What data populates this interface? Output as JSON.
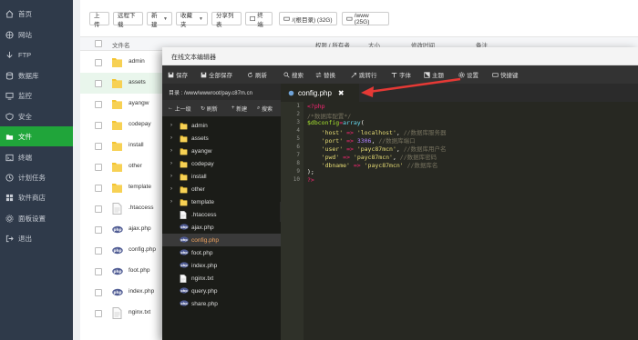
{
  "sidebar": {
    "items": [
      {
        "label": "首页",
        "icon": "home-icon"
      },
      {
        "label": "网站",
        "icon": "globe-icon"
      },
      {
        "label": "FTP",
        "icon": "ftp-icon"
      },
      {
        "label": "数据库",
        "icon": "database-icon"
      },
      {
        "label": "监控",
        "icon": "monitor-icon"
      },
      {
        "label": "安全",
        "icon": "shield-icon"
      },
      {
        "label": "文件",
        "icon": "folder-icon",
        "active": true
      },
      {
        "label": "终端",
        "icon": "terminal-icon"
      },
      {
        "label": "计划任务",
        "icon": "clock-icon"
      },
      {
        "label": "软件商店",
        "icon": "store-icon"
      },
      {
        "label": "面板设置",
        "icon": "gear-icon"
      },
      {
        "label": "退出",
        "icon": "logout-icon"
      }
    ]
  },
  "toolbar": {
    "upload": "上传",
    "remote_download": "远程下载",
    "new": "新建",
    "favorites": "收藏夹",
    "share_list": "分享列表",
    "terminal": "终端",
    "disk_root": "/(根目录) (32G)",
    "disk_www": "/www (25G)"
  },
  "table": {
    "headers": {
      "name": "文件名",
      "perm": "权限 / 所有者",
      "size": "大小",
      "mtime": "修改时间",
      "remark": "备注"
    },
    "rows": [
      {
        "name": "admin",
        "type": "folder"
      },
      {
        "name": "assets",
        "type": "folder"
      },
      {
        "name": "ayangw",
        "type": "folder"
      },
      {
        "name": "codepay",
        "type": "folder"
      },
      {
        "name": "install",
        "type": "folder"
      },
      {
        "name": "other",
        "type": "folder"
      },
      {
        "name": "template",
        "type": "folder"
      },
      {
        "name": ".htaccess",
        "type": "file"
      },
      {
        "name": "ajax.php",
        "type": "php"
      },
      {
        "name": "config.php",
        "type": "php"
      },
      {
        "name": "foot.php",
        "type": "php"
      },
      {
        "name": "index.php",
        "type": "php"
      },
      {
        "name": "nginx.txt",
        "type": "file"
      }
    ]
  },
  "editor": {
    "title": "在线文本编辑器",
    "menu": {
      "save": "保存",
      "save_all": "全部保存",
      "refresh": "刷新",
      "search": "搜索",
      "replace": "替换",
      "goto": "跳转行",
      "font": "字体",
      "theme": "主题",
      "settings": "设置",
      "shortcuts": "快捷键"
    },
    "path_label": "目录 : /www/wwwroot/pay.c87m.cn",
    "left_toolbar": {
      "up": "上一级",
      "refresh": "刷新",
      "new": "新建",
      "search": "搜索"
    },
    "tree": [
      {
        "name": "admin",
        "type": "folder"
      },
      {
        "name": "assets",
        "type": "folder"
      },
      {
        "name": "ayangw",
        "type": "folder"
      },
      {
        "name": "codepay",
        "type": "folder"
      },
      {
        "name": "install",
        "type": "folder"
      },
      {
        "name": "other",
        "type": "folder"
      },
      {
        "name": "template",
        "type": "folder"
      },
      {
        "name": ".htaccess",
        "type": "file"
      },
      {
        "name": "ajax.php",
        "type": "php"
      },
      {
        "name": "config.php",
        "type": "php",
        "selected": true
      },
      {
        "name": "foot.php",
        "type": "php"
      },
      {
        "name": "index.php",
        "type": "php"
      },
      {
        "name": "nginx.txt",
        "type": "file"
      },
      {
        "name": "query.php",
        "type": "php"
      },
      {
        "name": "share.php",
        "type": "php"
      }
    ],
    "tab": {
      "name": "config.php",
      "close": "✖"
    },
    "collapse": "‹",
    "line_numbers": [
      "1",
      "2",
      "3",
      "4",
      "5",
      "6",
      "7",
      "8",
      "9",
      "10"
    ],
    "code": {
      "l1": "<?php",
      "l2": "/*数据库配置*/",
      "l3a": "$dbconfig",
      "l3b": "=",
      "l3c": "array",
      "l3d": "(",
      "key_host": "'host'",
      "val_host": "'localhost'",
      "cmt_host": "//数据库服务器",
      "key_port": "'port'",
      "val_port": "3306",
      "cmt_port": "//数据库端口",
      "key_user": "'user'",
      "val_user": "'payc87mcn'",
      "cmt_user": "//数据库用户名",
      "key_pwd": "'pwd'",
      "val_pwd": "'payc87mcn'",
      "cmt_pwd": "//数据库密码",
      "key_db": "'dbname'",
      "val_db": "'payc87mcn'",
      "cmt_db": "//数据库名",
      "arrow": "=>",
      "comma": ",",
      "l9": ");",
      "l10": "?>"
    }
  },
  "colors": {
    "accent": "#20a53a",
    "sidebar_bg": "#2f3a4a",
    "editor_bg": "#272822",
    "annotation_arrow": "#e53935"
  }
}
